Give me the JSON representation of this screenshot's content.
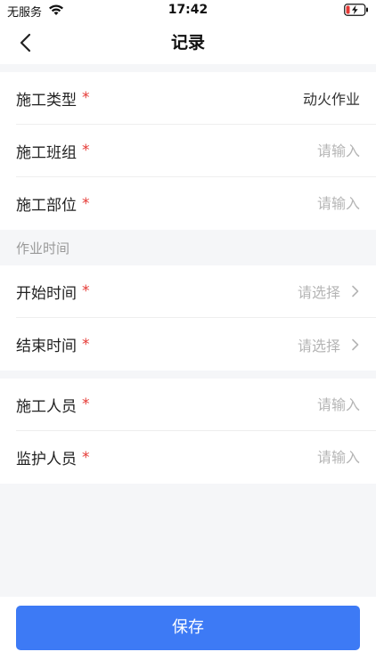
{
  "status_bar": {
    "carrier": "无服务",
    "time": "17:42"
  },
  "nav": {
    "title": "记录"
  },
  "group1": {
    "rows": [
      {
        "label": "施工类型",
        "required": "*",
        "value": "动火作业"
      },
      {
        "label": "施工班组",
        "required": "*",
        "placeholder": "请输入"
      },
      {
        "label": "施工部位",
        "required": "*",
        "placeholder": "请输入"
      }
    ]
  },
  "section_title": "作业时间",
  "group2": {
    "rows": [
      {
        "label": "开始时间",
        "required": "*",
        "placeholder": "请选择"
      },
      {
        "label": "结束时间",
        "required": "*",
        "placeholder": "请选择"
      }
    ]
  },
  "group3": {
    "rows": [
      {
        "label": "施工人员",
        "required": "*",
        "placeholder": "请输入"
      },
      {
        "label": "监护人员",
        "required": "*",
        "placeholder": "请输入"
      }
    ]
  },
  "save_label": "保存",
  "colors": {
    "accent": "#3d7af5",
    "required": "#e53935",
    "background": "#f5f6f8"
  }
}
